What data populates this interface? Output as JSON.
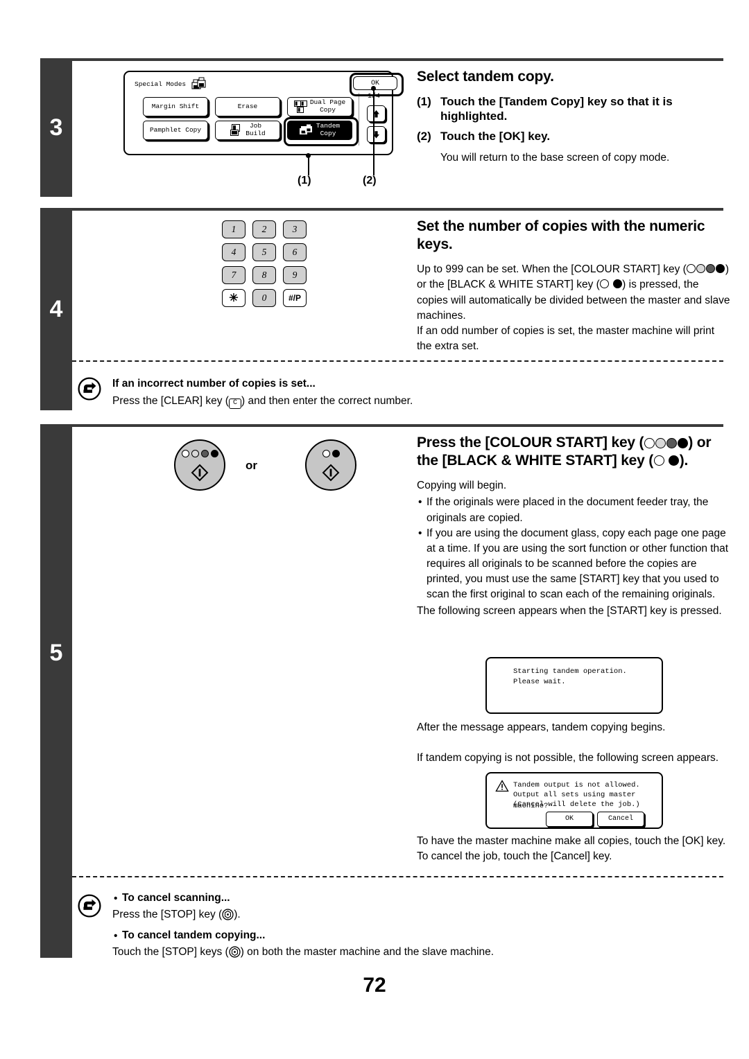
{
  "page": {
    "number": "72"
  },
  "steps": [
    {
      "number": "3",
      "title": "Select tandem copy.",
      "items": [
        {
          "marker": "(1)",
          "text": "Touch the [Tandem Copy] key so that it is highlighted."
        },
        {
          "marker": "(2)",
          "text": "Touch the [OK] key."
        }
      ],
      "note": "You will return to the base screen of copy mode.",
      "lcd": {
        "header": "Special Modes",
        "header_icon": "tandem-copy-icon",
        "ok_label": "OK",
        "page_indicator": "1/4",
        "up_icon": "arrow-up-icon",
        "down_icon": "arrow-down-icon",
        "keys": [
          {
            "label": "Margin Shift",
            "selected": false,
            "icon": ""
          },
          {
            "label": "Erase",
            "selected": false,
            "icon": ""
          },
          {
            "label": "Dual Page\nCopy",
            "selected": false,
            "icon": "dual-page-copy-icon"
          },
          {
            "label": "Pamphlet Copy",
            "selected": false,
            "icon": ""
          },
          {
            "label": "Job\nBuild",
            "selected": false,
            "icon": "job-build-icon"
          },
          {
            "label": "Tandem\nCopy",
            "selected": true,
            "icon": "tandem-copy-icon"
          }
        ],
        "callouts": [
          "(1)",
          "(2)"
        ]
      }
    },
    {
      "number": "4",
      "title": "Set the number of copies with the numeric keys.",
      "paragraphs": [
        "Up to 999 can be set. When the [COLOUR START] key (",
        ") or the [BLACK & WHITE START] key (",
        ") is pressed, the copies will automatically be divided between the master and slave machines.",
        "If an odd number of copies is set, the master machine will print the extra set."
      ],
      "keypad": {
        "rows": [
          [
            "1",
            "2",
            "3"
          ],
          [
            "4",
            "5",
            "6"
          ],
          [
            "7",
            "8",
            "9"
          ],
          [
            "✳",
            "0",
            "#/P"
          ]
        ]
      }
    },
    {
      "number": "5",
      "title_parts": [
        "Press the [COLOUR START] key (",
        ") or the [BLACK & WHITE START] key (",
        ")."
      ],
      "intro": "Copying will begin.",
      "bullets": [
        "If the originals were placed in the document feeder tray, the originals are copied.",
        "If you are using the document glass, copy each page one page at a time. If you are using the sort function or other function that requires all originals to be scanned before the copies are printed, you must use the same [START] key that you used to scan the first original to scan each of the remaining originals."
      ],
      "after_bullets": "The following screen appears when the [START] key is pressed.",
      "dialog1": {
        "line1": "Starting tandem operation.",
        "line2": "Please wait."
      },
      "after_dialog1": "After the message appears, tandem copying begins.",
      "before_dialog2": "If tandem copying is not possible, the following screen appears.",
      "dialog2": {
        "icon": "warning-triangle-icon",
        "line1": "Tandem output is not allowed.",
        "line2": "Output all sets using master machine?",
        "line3": "(Cancel will delete the job.)",
        "ok_label": "OK",
        "cancel_label": "Cancel"
      },
      "after_dialog2": "To have the master machine make all copies, touch the [OK] key. To cancel the job, touch the [Cancel] key.",
      "start_buttons": {
        "or_label": "or",
        "colour_icon": "colour-start-button",
        "bw_icon": "black-white-start-button"
      }
    }
  ],
  "notes": [
    {
      "icon": "back-arrow-icon",
      "heading": "If an incorrect number of copies is set...",
      "body_before": "Press the [CLEAR] key (",
      "key_label": "C",
      "body_after": ") and then enter the correct number."
    },
    {
      "icon": "back-arrow-icon",
      "lines": [
        {
          "heading": "To cancel scanning...",
          "before": "Press the [STOP] key (",
          "key_icon": "stop-key-icon",
          "after": ")."
        },
        {
          "heading": "To cancel tandem copying...",
          "before": "Touch the [STOP] keys (",
          "key_icon": "stop-key-icon",
          "after": ") on both the master machine and the slave machine."
        }
      ]
    }
  ],
  "colors": {
    "bar": "#3a3a3a",
    "key_gray": "#d0d0d0",
    "button_gray": "#c6c6c6"
  }
}
